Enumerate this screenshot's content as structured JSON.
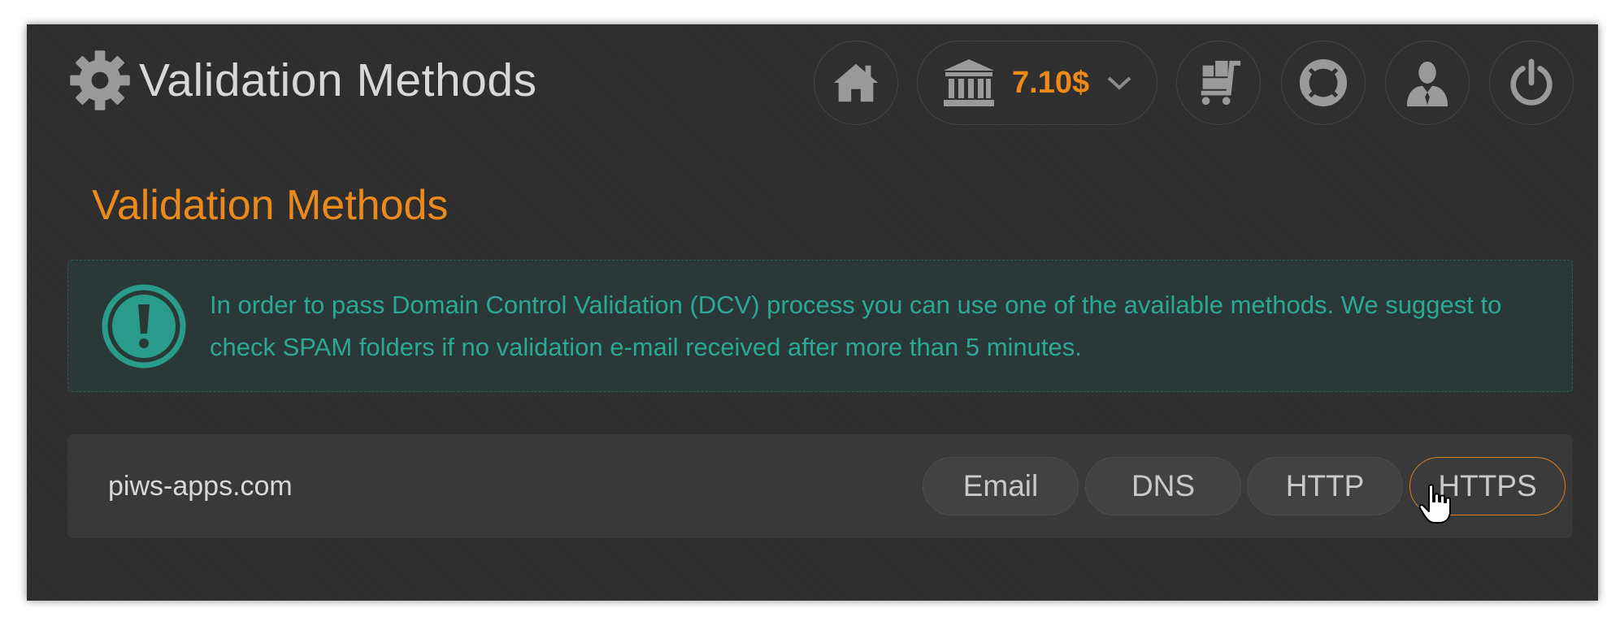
{
  "header": {
    "title": "Validation Methods",
    "title_icon": "gear-icon",
    "nav_icons": [
      "home-icon",
      "bank-icon",
      "cart-icon",
      "lifebuoy-icon",
      "user-icon",
      "power-icon"
    ],
    "balance": "7.10$"
  },
  "section": {
    "title": "Validation Methods"
  },
  "alert": {
    "icon": "exclamation-icon",
    "text": "In order to pass Domain Control Validation (DCV) process you can use one of the available methods. We suggest to check SPAM folders if no validation e-mail received after more than 5 minutes."
  },
  "domain": {
    "name": "piws-apps.com",
    "methods": [
      "Email",
      "DNS",
      "HTTP",
      "HTTPS"
    ],
    "selected": "HTTPS"
  },
  "colors": {
    "accent": "#ea8a1c",
    "alert_text": "#2ba896",
    "background": "#2e2e2e"
  }
}
